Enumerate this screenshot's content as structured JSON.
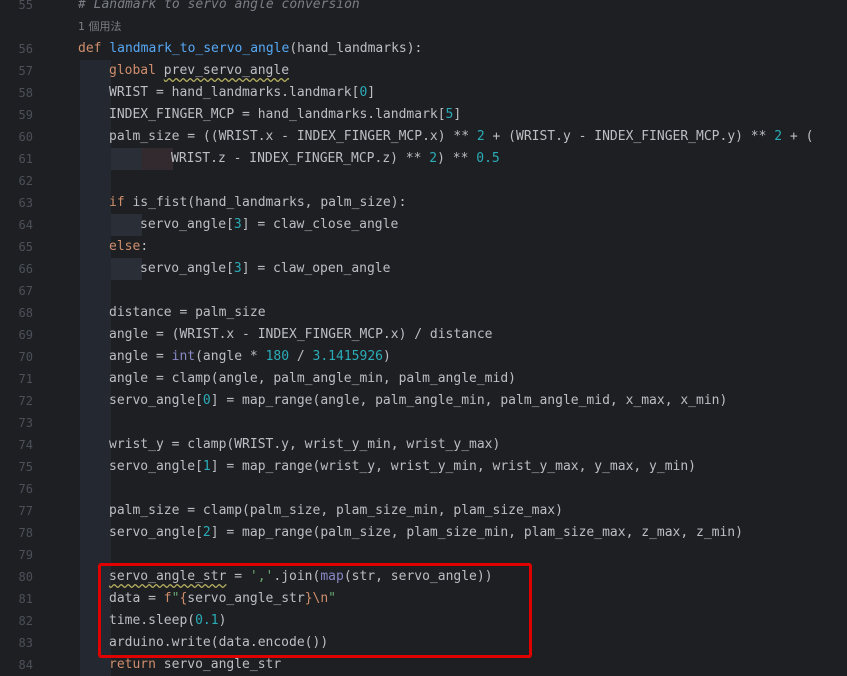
{
  "editor": {
    "comment_line": {
      "number": "55",
      "text": "# Landmark to servo angle conversion"
    },
    "usage_hint": "1 個用法",
    "lines": [
      {
        "number": "56",
        "text": "def landmark_to_servo_angle(hand_landmarks):"
      },
      {
        "number": "57",
        "text": "global prev_servo_angle"
      },
      {
        "number": "58",
        "text": "WRIST = hand_landmarks.landmark[0]"
      },
      {
        "number": "59",
        "text": "INDEX_FINGER_MCP = hand_landmarks.landmark[5]"
      },
      {
        "number": "60",
        "text": "palm_size = ((WRIST.x - INDEX_FINGER_MCP.x) ** 2 + (WRIST.y - INDEX_FINGER_MCP.y) ** 2 + ("
      },
      {
        "number": "61",
        "text": "WRIST.z - INDEX_FINGER_MCP.z) ** 2) ** 0.5"
      },
      {
        "number": "62",
        "text": ""
      },
      {
        "number": "63",
        "text": "if is_fist(hand_landmarks, palm_size):"
      },
      {
        "number": "64",
        "text": "servo_angle[3] = claw_close_angle"
      },
      {
        "number": "65",
        "text": "else:"
      },
      {
        "number": "66",
        "text": "servo_angle[3] = claw_open_angle"
      },
      {
        "number": "67",
        "text": ""
      },
      {
        "number": "68",
        "text": "distance = palm_size"
      },
      {
        "number": "69",
        "text": "angle = (WRIST.x - INDEX_FINGER_MCP.x) / distance"
      },
      {
        "number": "70",
        "text": "angle = int(angle * 180 / 3.1415926)"
      },
      {
        "number": "71",
        "text": "angle = clamp(angle, palm_angle_min, palm_angle_mid)"
      },
      {
        "number": "72",
        "text": "servo_angle[0] = map_range(angle, palm_angle_min, palm_angle_mid, x_max, x_min)"
      },
      {
        "number": "73",
        "text": ""
      },
      {
        "number": "74",
        "text": "wrist_y = clamp(WRIST.y, wrist_y_min, wrist_y_max)"
      },
      {
        "number": "75",
        "text": "servo_angle[1] = map_range(wrist_y, wrist_y_min, wrist_y_max, y_max, y_min)"
      },
      {
        "number": "76",
        "text": ""
      },
      {
        "number": "77",
        "text": "palm_size = clamp(palm_size, plam_size_min, plam_size_max)"
      },
      {
        "number": "78",
        "text": "servo_angle[2] = map_range(palm_size, plam_size_min, plam_size_max, z_max, z_min)"
      },
      {
        "number": "79",
        "text": ""
      },
      {
        "number": "80",
        "text": "servo_angle_str = ','.join(map(str, servo_angle))"
      },
      {
        "number": "81",
        "text": "data = f\"{servo_angle_str}\\n\""
      },
      {
        "number": "82",
        "text": "time.sleep(0.1)"
      },
      {
        "number": "83",
        "text": "arduino.write(data.encode())"
      },
      {
        "number": "84",
        "text": "return servo_angle_str"
      }
    ]
  },
  "colors": {
    "background": "#1e1f22",
    "keyword": "#cf8e6d",
    "function": "#56a8f5",
    "number": "#2aacb8",
    "string": "#6aab73",
    "comment": "#7a7e85",
    "annotation_box": "#e00000"
  }
}
